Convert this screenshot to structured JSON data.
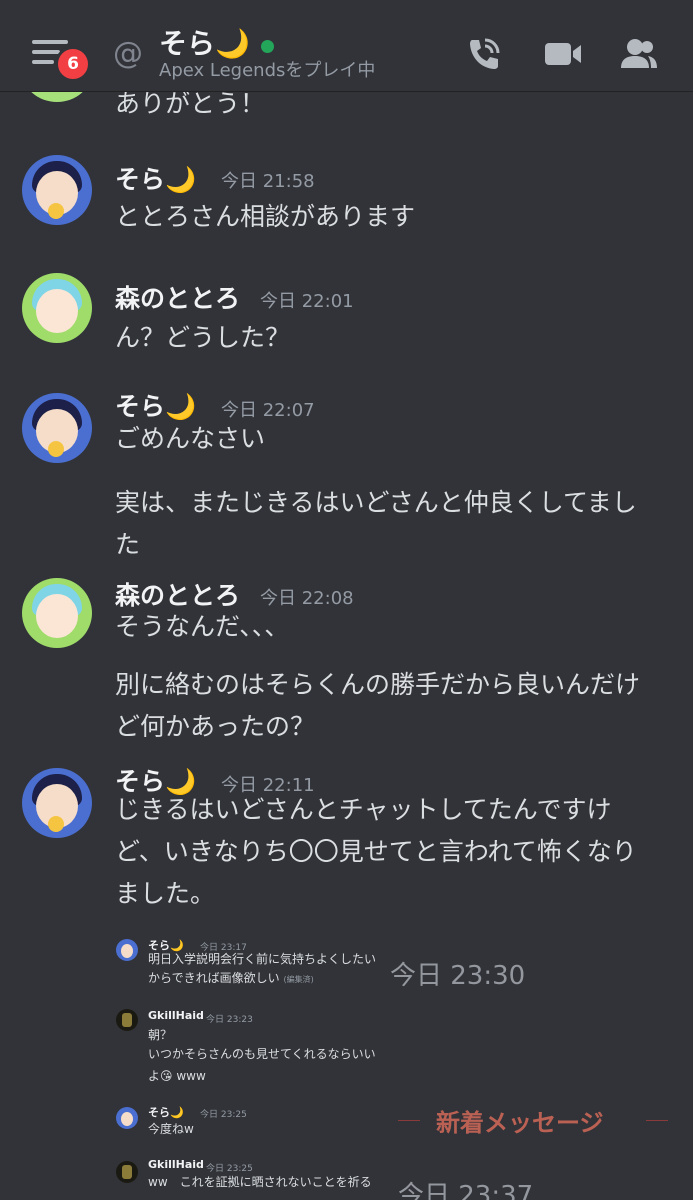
{
  "header": {
    "badge": "6",
    "name": "そら🌙",
    "status": "Apex Legendsをプレイ中"
  },
  "partial_message": "ありがとう！",
  "messages": [
    {
      "author": "そら🌙",
      "time": "今日 21:58",
      "lines": [
        "ととろさん相談があります"
      ]
    },
    {
      "author": "森のととろ",
      "time": "今日 22:01",
      "lines": [
        "ん？どうした？"
      ]
    },
    {
      "author": "そら🌙",
      "time": "今日 22:07",
      "lines": [
        "ごめんなさい",
        "実は、またじきるはいどさんと仲良くしてまし",
        "た"
      ]
    },
    {
      "author": "森のととろ",
      "time": "今日 22:08",
      "lines": [
        "そうなんだ、、、",
        "別に絡むのはそらくんの勝手だから良いんだけ",
        "ど何かあったの？"
      ]
    },
    {
      "author": "そら🌙",
      "time": "今日 22:11",
      "lines": [
        "じきるはいどさんとチャットしてたんですけ",
        "ど、いきなりち〇〇見せてと言われて怖くなり",
        "ました。"
      ]
    }
  ],
  "embed": {
    "messages": [
      {
        "author": "そら🌙",
        "time": "今日 23:17",
        "lines": [
          "明日入学説明会行く前に気持ちよくしたい",
          "からできれば画像欲しい"
        ],
        "edited": "(編集済)"
      },
      {
        "author": "GkillHaid",
        "time": "今日 23:23",
        "lines": [
          "朝？",
          "いつかそらさんのも見せてくれるならいい",
          "よ😘 www"
        ]
      },
      {
        "author": "そら🌙",
        "time": "今日 23:25",
        "lines": [
          "今度ねw"
        ]
      },
      {
        "author": "GkillHaid",
        "time": "今日 23:25",
        "lines": [
          "ww　これを証拠に晒されないことを祈る"
        ]
      }
    ],
    "stamps": [
      "今日 23:30",
      "今日 23:37"
    ],
    "new_messages_label": "新着メッセージ"
  },
  "colors": {
    "background": "#313338",
    "text": "#dbdee1",
    "muted": "#949ba4",
    "badge": "#f23f43",
    "online": "#23a55a",
    "new_divider": "#d46a5a"
  },
  "icons": {
    "menu": "hamburger-icon",
    "at": "at-icon",
    "call": "phone-call-icon",
    "video": "video-camera-icon",
    "members": "members-icon"
  }
}
